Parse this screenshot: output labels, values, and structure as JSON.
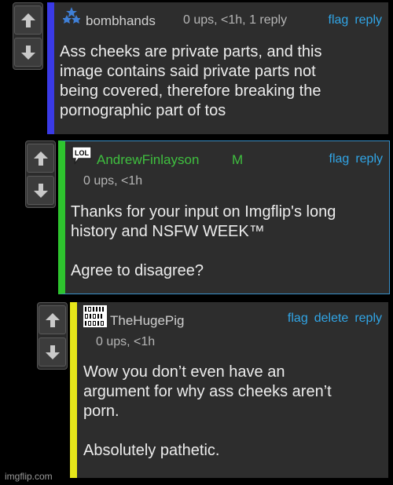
{
  "colors": {
    "background": "#000000",
    "card": "#2d2d2d",
    "link": "#31a5e6",
    "username_green": "#3fbf3f",
    "bar_blue": "#3a3ae6",
    "bar_green": "#2ec42e",
    "bar_yellow": "#e6e61a"
  },
  "comments": [
    {
      "avatar_icon": "stars-triangle-icon",
      "username": "bombhands",
      "meta": "0 ups, <1h, 1 reply",
      "actions": [
        "flag",
        "reply"
      ],
      "body": "Ass cheeks are private parts, and this\nimage contains said private parts not\nbeing covered, therefore breaking the\npornographic part of tos"
    },
    {
      "avatar_icon": "lol-speech-bubble-icon",
      "avatar_text": "LOL",
      "username": "AndrewFinlayson",
      "badge": "M",
      "meta": "0 ups, <1h",
      "actions": [
        "flag",
        "reply"
      ],
      "body": "Thanks for your input on Imgflip's long\nhistory and NSFW WEEK™\n\nAgree to disagree?"
    },
    {
      "avatar_icon": "binary-code-icon",
      "username": "TheHugePig",
      "meta": "0 ups, <1h",
      "actions": [
        "flag",
        "delete",
        "reply"
      ],
      "body": "Wow you don’t even have an\nargument for why ass cheeks aren’t\nporn.\n\nAbsolutely pathetic."
    }
  ],
  "watermark": "imgflip.com"
}
